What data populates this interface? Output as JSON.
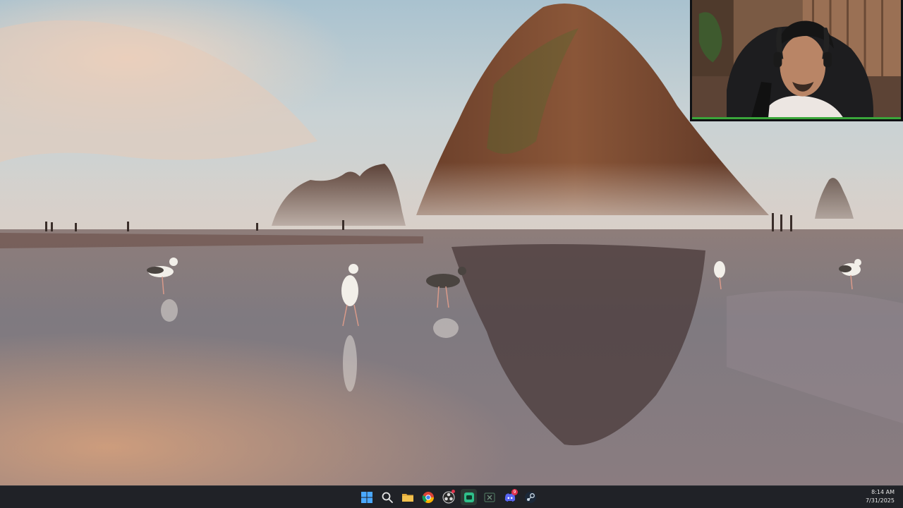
{
  "taskbar": {
    "apps": [
      {
        "name": "start-button",
        "icon": "windows-icon",
        "color": "#4aa8ff"
      },
      {
        "name": "search-button",
        "icon": "search-icon",
        "color": "#e6e6e6"
      },
      {
        "name": "file-explorer-button",
        "icon": "folder-icon",
        "color": "#f2c14e"
      },
      {
        "name": "chrome-button",
        "icon": "chrome-icon",
        "color": "#4285f4"
      },
      {
        "name": "obs-button",
        "icon": "obs-icon",
        "color": "#d8d8d8"
      },
      {
        "name": "app-green-button",
        "icon": "app-icon",
        "color": "#2fbf8a"
      },
      {
        "name": "excel-button",
        "icon": "spreadsheet-icon",
        "color": "#1f8f4e"
      },
      {
        "name": "discord-button",
        "icon": "discord-icon",
        "color": "#5865f2",
        "badge": "9"
      },
      {
        "name": "steam-button",
        "icon": "steam-icon",
        "color": "#c7d5e0"
      }
    ],
    "clock": {
      "time": "8:14 AM",
      "date": "7/31/2025"
    }
  },
  "colors": {
    "taskbar": "#202227",
    "webcam_accent": "#3aa63a"
  }
}
